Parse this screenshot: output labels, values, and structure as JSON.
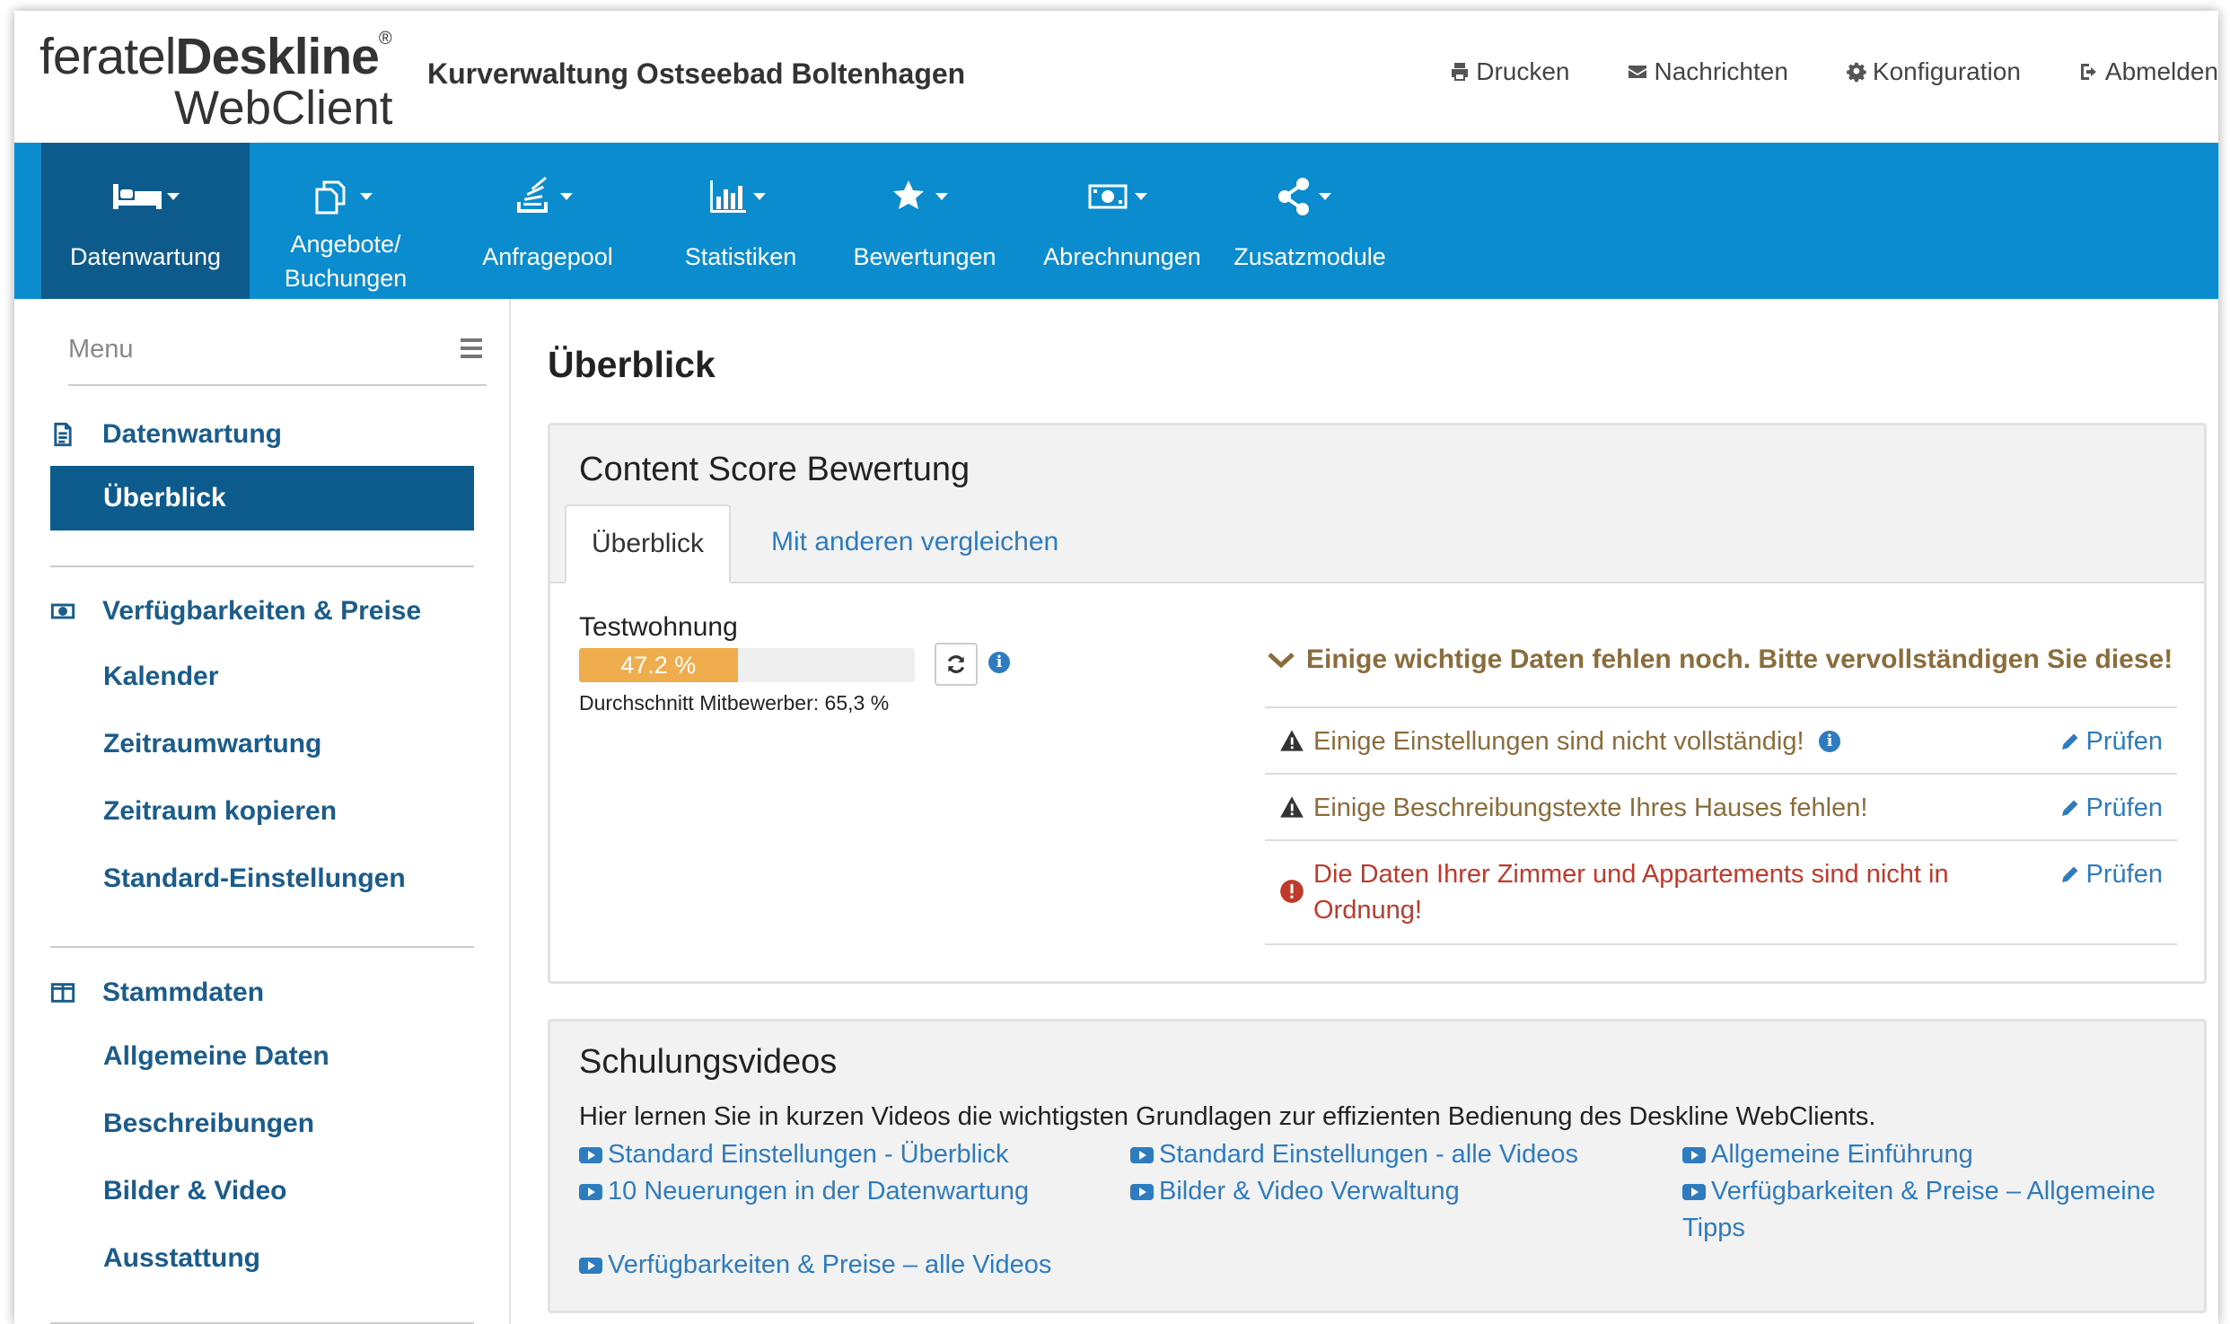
{
  "header": {
    "logo_part1": "feratel",
    "logo_part2": "Deskline",
    "logo_reg": "®",
    "logo_line2": "WebClient",
    "org_name": "Kurverwaltung Ostseebad Boltenhagen",
    "links": {
      "print": "Drucken",
      "messages": "Nachrichten",
      "config": "Konfiguration",
      "logout": "Abmelden"
    }
  },
  "nav": {
    "datenwartung": "Datenwartung",
    "angebote_1": "Angebote/",
    "angebote_2": "Buchungen",
    "anfragepool": "Anfragepool",
    "statistiken": "Statistiken",
    "bewertungen": "Bewertungen",
    "abrechnungen": "Abrechnungen",
    "zusatzmodule": "Zusatzmodule"
  },
  "sidebar": {
    "menu_label": "Menu",
    "section1_title": "Datenwartung",
    "section1_active": "Überblick",
    "section2_title": "Verfügbarkeiten & Preise",
    "section2_items": [
      "Kalender",
      "Zeitraumwartung",
      "Zeitraum kopieren",
      "Standard-Einstellungen"
    ],
    "section3_title": "Stammdaten",
    "section3_items": [
      "Allgemeine Daten",
      "Beschreibungen",
      "Bilder & Video",
      "Ausstattung"
    ]
  },
  "main": {
    "page_title": "Überblick",
    "content_score": {
      "title": "Content Score Bewertung",
      "tab_overview": "Überblick",
      "tab_compare": "Mit anderen vergleichen",
      "object_name": "Testwohnung",
      "score_fraction": 0.472,
      "score_label": "47.2 %",
      "average": "Durchschnitt Mitbewerber: 65,3 %",
      "warning_header": "Einige wichtige Daten fehlen noch. Bitte vervollständigen Sie diese!",
      "check_label": "Prüfen",
      "warnings": [
        {
          "line1": "Einige Einstellungen sind nicht vollständig!",
          "line2": ""
        },
        {
          "line1": "Einige Beschreibungstexte Ihres Hauses fehlen!",
          "line2": ""
        },
        {
          "line1": "Die Daten Ihrer Zimmer und Appartements sind nicht in",
          "line2": "Ordnung!"
        }
      ]
    },
    "videos": {
      "title": "Schulungsvideos",
      "intro": "Hier lernen Sie in kurzen Videos die wichtigsten Grundlagen zur effizienten Bedienung des Deskline WebClients.",
      "links": [
        "Standard Einstellungen - Überblick",
        "Standard Einstellungen - alle Videos",
        "Allgemeine Einführung",
        "10 Neuerungen in der Datenwartung",
        "Bilder & Video Verwaltung",
        "Verfügbarkeiten & Preise – Allgemeine",
        "Tipps",
        "Verfügbarkeiten & Preise – alle Videos"
      ]
    }
  },
  "colors": {
    "nav_blue": "#0a8ccf",
    "nav_active": "#0c5b8c",
    "link_blue": "#2f7bbf",
    "progress_orange": "#f0ad4e",
    "warning_brown": "#8a6d3b",
    "danger_red": "#c0392b"
  }
}
